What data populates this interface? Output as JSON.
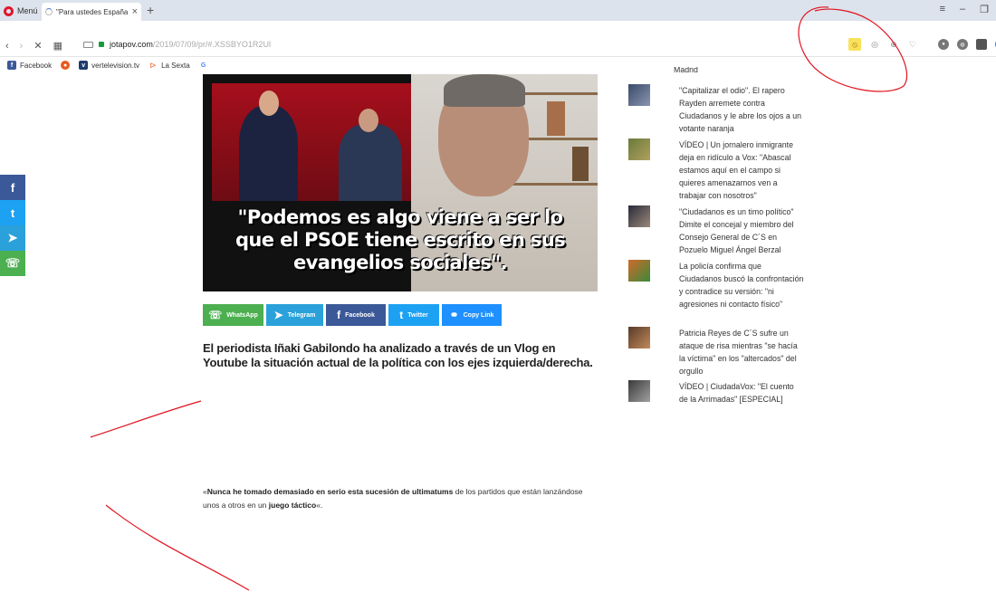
{
  "browser": {
    "menu_label": "Menú",
    "tab_title": "\"Para ustedes España es lo",
    "tab_close": "×",
    "new_tab": "+",
    "win_controls": [
      "≡",
      "–",
      "❐"
    ],
    "url_host": "jotapov.com",
    "url_path": "/2019/07/09/pr/#.XSSBYO1R2Ul",
    "bookmarks": [
      {
        "label": "Facebook",
        "icon": "facebook-icon",
        "color": "#3b5998",
        "glyph": "f"
      },
      {
        "label": "",
        "icon": "reddit-icon",
        "color": "#e85a1e",
        "glyph": "●"
      },
      {
        "label": "vertelevision.tv",
        "icon": "vertelevision-icon",
        "color": "#1c3a6e",
        "glyph": "v"
      },
      {
        "label": "La Sexta",
        "icon": "lasexta-icon",
        "color": "#4caa3a",
        "glyph": "▷"
      },
      {
        "label": "",
        "icon": "google-icon",
        "color": "#4285f4",
        "glyph": "G"
      }
    ]
  },
  "colors": {
    "facebook": "#3b5998",
    "twitter": "#1da1f2",
    "telegram": "#2aa1da",
    "whatsapp": "#4caf50",
    "scribble": "#e0131f"
  },
  "share_side": [
    {
      "icon": "facebook-icon",
      "glyph": "f",
      "color": "#3b5998"
    },
    {
      "icon": "twitter-icon",
      "glyph": "t",
      "color": "#1da1f2"
    },
    {
      "icon": "telegram-icon",
      "glyph": "➤",
      "color": "#2aa1da"
    },
    {
      "icon": "whatsapp-icon",
      "glyph": "☏",
      "color": "#4caf50"
    }
  ],
  "hero": {
    "caption_line1": "\"Podemos es algo viene a ser lo",
    "caption_line2": "que el PSOE tiene escrito en sus",
    "caption_line3": "evangelios sociales\"."
  },
  "share_buttons": [
    {
      "label": "WhatsApp",
      "icon": "whatsapp-icon",
      "glyph": "☏",
      "color": "#4caf50"
    },
    {
      "label": "Telegram",
      "icon": "telegram-icon",
      "glyph": "➤",
      "color": "#2aa1da"
    },
    {
      "label": "Facebook",
      "icon": "facebook-icon",
      "glyph": "f",
      "color": "#3b5998"
    },
    {
      "label": "Twitter",
      "icon": "twitter-icon",
      "glyph": "t",
      "color": "#1da1f2"
    },
    {
      "label": "Copy Link",
      "icon": "link-icon",
      "glyph": "⚭",
      "color": "#1e90ff"
    }
  ],
  "article": {
    "lead": "El periodista Iñaki Gabilondo ha analizado a través de un Vlog en Youtube la situación actual de la política con los ejes izquierda/derecha.",
    "quote_open": "«",
    "quote_bold1": "Nunca he tomado demasiado en serio esta sucesión de ultimatums",
    "quote_mid": " de los partidos que están lanzándose unos a otros en un ",
    "quote_bold2": "juego táctico",
    "quote_close": "«."
  },
  "sidebar": {
    "partial_top": "Madrid",
    "items": [
      {
        "text": "\"Capitalizar el odio\". El rapero Rayden arremete contra Ciudadanos y le abre los ojos a un votante naranja"
      },
      {
        "text": "VÍDEO | Un jornalero inmigrante deja en ridículo a Vox: \"Abascal estamos aquí en el campo si quieres amenazarnos ven a trabajar con nosotros\""
      },
      {
        "text": "\"Ciudadanos es un timo político\" Dimite el concejal y miembro del Consejo General de C´S en Pozuelo Miguel Ángel Berzal"
      },
      {
        "text": "La policía confirma que Ciudadanos buscó la confrontación y contradice su versión: \"ni agresiones ni contacto físico\""
      },
      {
        "text": "Patricia Reyes de C´S sufre un ataque de risa mientras \"se hacía la víctima\" en los \"altercados\" del orgullo"
      },
      {
        "text": "VÍDEO | CiudadaVox: \"El cuento de la Arrimadas\" [ESPECIAL]"
      }
    ]
  }
}
